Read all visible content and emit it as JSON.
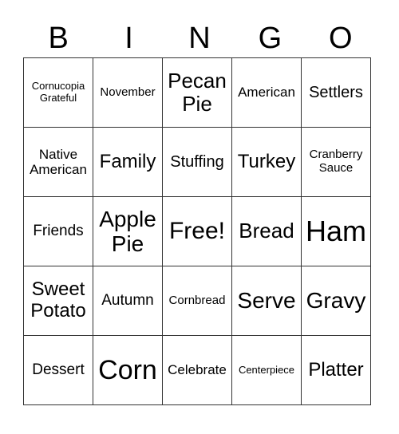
{
  "header": [
    "B",
    "I",
    "N",
    "G",
    "O"
  ],
  "rows": [
    [
      "Cornucopia Grateful",
      "November",
      "Pecan Pie",
      "American",
      "Settlers"
    ],
    [
      "Native American",
      "Family",
      "Stuffing",
      "Turkey",
      "Cranberry Sauce"
    ],
    [
      "Friends",
      "Apple Pie",
      "Free!",
      "Bread",
      "Ham"
    ],
    [
      "Sweet Potato",
      "Autumn",
      "Cornbread",
      "Serve",
      "Gravy"
    ],
    [
      "Dessert",
      "Corn",
      "Celebrate",
      "Centerpiece",
      "Platter"
    ]
  ]
}
